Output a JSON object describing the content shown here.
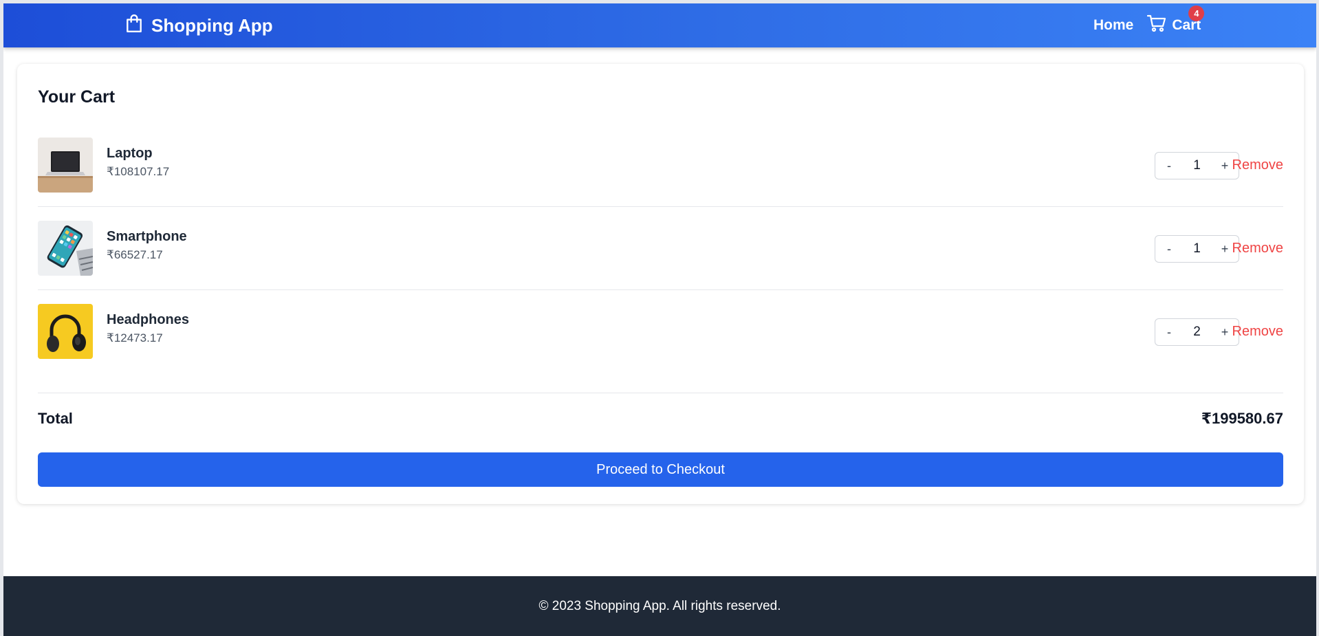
{
  "header": {
    "brand": "Shopping App",
    "nav": {
      "home": "Home",
      "cart": "Cart",
      "cart_count": "4"
    }
  },
  "cart": {
    "title": "Your Cart",
    "items": [
      {
        "name": "Laptop",
        "price": "₹108107.17",
        "quantity": "1",
        "remove_label": "Remove",
        "image": "laptop-image"
      },
      {
        "name": "Smartphone",
        "price": "₹66527.17",
        "quantity": "1",
        "remove_label": "Remove",
        "image": "smartphone-image"
      },
      {
        "name": "Headphones",
        "price": "₹12473.17",
        "quantity": "2",
        "remove_label": "Remove",
        "image": "headphones-image"
      }
    ],
    "decrement_label": "-",
    "increment_label": "+",
    "total_label": "Total",
    "total_value": "₹199580.67",
    "checkout_label": "Proceed to Checkout"
  },
  "footer": {
    "text": "© 2023 Shopping App. All rights reserved."
  },
  "colors": {
    "header_start": "#1d4ed8",
    "header_end": "#3b82f6",
    "accent": "#2563eb",
    "remove": "#ef4444",
    "badge": "#e03e48",
    "footer": "#1f2937"
  }
}
